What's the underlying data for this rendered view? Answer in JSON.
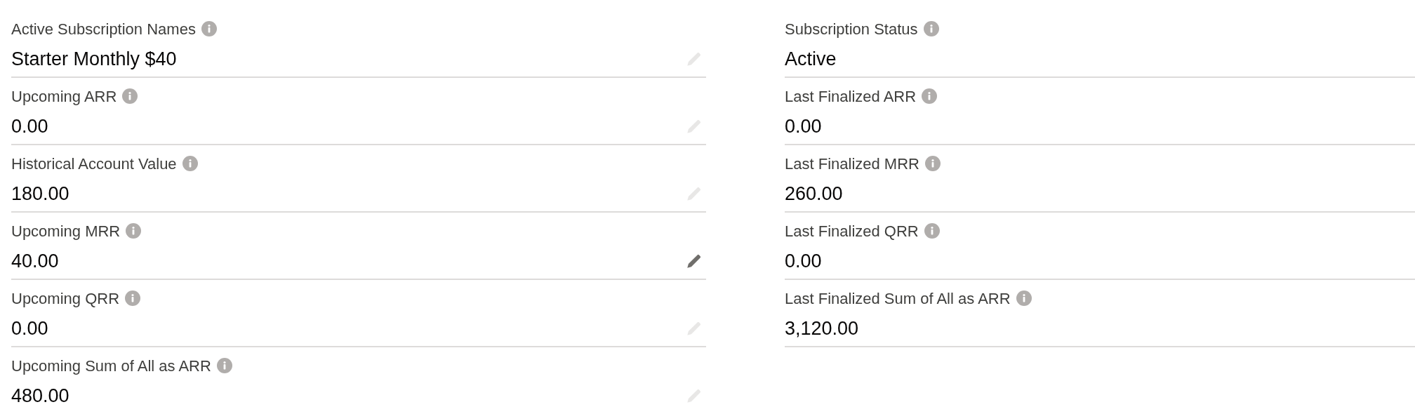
{
  "columns": [
    {
      "fields": [
        {
          "label": "Active Subscription Names",
          "value": "Starter Monthly $40",
          "editable": true,
          "highlighted": false
        },
        {
          "label": "Upcoming ARR",
          "value": "0.00",
          "editable": true,
          "highlighted": false
        },
        {
          "label": "Historical Account Value",
          "value": "180.00",
          "editable": true,
          "highlighted": false
        },
        {
          "label": "Upcoming MRR",
          "value": "40.00",
          "editable": true,
          "highlighted": true
        },
        {
          "label": "Upcoming QRR",
          "value": "0.00",
          "editable": true,
          "highlighted": false
        },
        {
          "label": "Upcoming Sum of All as ARR",
          "value": "480.00",
          "editable": true,
          "highlighted": false
        }
      ]
    },
    {
      "fields": [
        {
          "label": "Subscription Status",
          "value": "Active"
        },
        {
          "label": "Last Finalized ARR",
          "value": "0.00"
        },
        {
          "label": "Last Finalized MRR",
          "value": "260.00"
        },
        {
          "label": "Last Finalized QRR",
          "value": "0.00"
        },
        {
          "label": "Last Finalized Sum of All as ARR",
          "value": "3,120.00"
        }
      ]
    }
  ]
}
